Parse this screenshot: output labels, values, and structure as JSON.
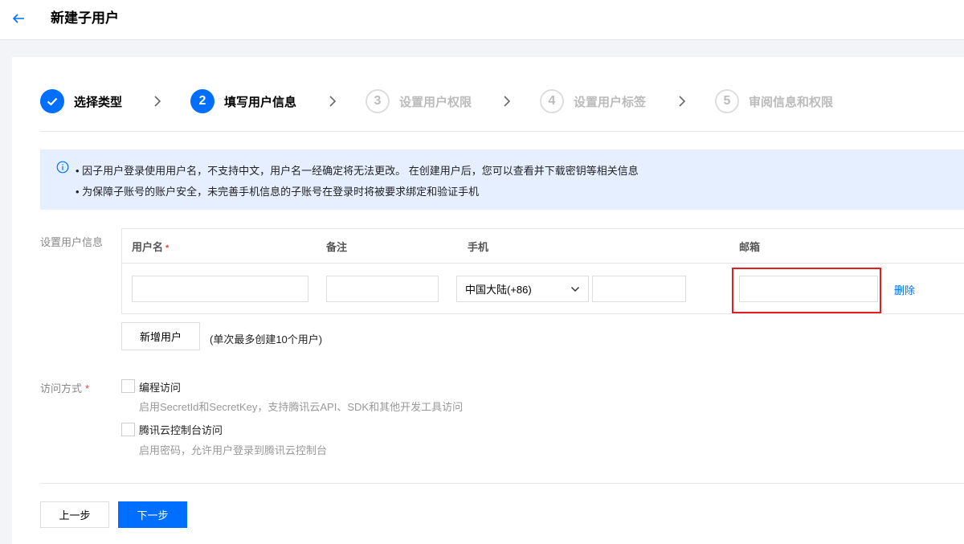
{
  "header": {
    "title": "新建子用户"
  },
  "steps": [
    {
      "number": "",
      "label": "选择类型",
      "state": "done"
    },
    {
      "number": "2",
      "label": "填写用户信息",
      "state": "active"
    },
    {
      "number": "3",
      "label": "设置用户权限",
      "state": "pending"
    },
    {
      "number": "4",
      "label": "设置用户标签",
      "state": "pending"
    },
    {
      "number": "5",
      "label": "审阅信息和权限",
      "state": "pending"
    }
  ],
  "notice": {
    "lines": [
      "• 因子用户登录使用用户名，不支持中文，用户名一经确定将无法更改。 在创建用户后，您可以查看并下载密钥等相关信息",
      "• 为保障子账号的账户安全，未完善手机信息的子账号在登录时将被要求绑定和验证手机"
    ]
  },
  "user_info": {
    "label": "设置用户信息",
    "columns": {
      "username": "用户名",
      "required_mark": "*",
      "remark": "备注",
      "phone": "手机",
      "email": "邮箱"
    },
    "row": {
      "username_value": "",
      "remark_value": "",
      "country_code": "中国大陆(+86)",
      "phone_value": "",
      "email_value": "",
      "delete_label": "删除"
    },
    "add_user_label": "新增用户",
    "add_user_hint": "(单次最多创建10个用户)"
  },
  "access": {
    "label": "访问方式",
    "required_mark": "*",
    "options": [
      {
        "title": "编程访问",
        "desc": "启用SecretId和SecretKey，支持腾讯云API、SDK和其他开发工具访问",
        "checked": false
      },
      {
        "title": "腾讯云控制台访问",
        "desc": "启用密码，允许用户登录到腾讯云控制台",
        "checked": false
      }
    ]
  },
  "footer": {
    "prev_label": "上一步",
    "next_label": "下一步"
  },
  "colors": {
    "primary": "#006eff",
    "notice_bg": "#e5efff",
    "highlight": "#e02020",
    "required": "#e54545"
  }
}
